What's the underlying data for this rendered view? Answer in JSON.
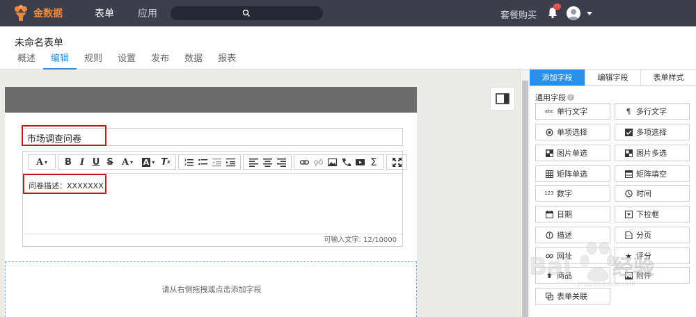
{
  "topnav": {
    "brand": "金数据",
    "items": [
      "表单",
      "应用"
    ],
    "buy_label": "套餐购买",
    "badge": "···"
  },
  "form": {
    "title": "未命名表单",
    "tabs": [
      "概述",
      "编辑",
      "规则",
      "设置",
      "发布",
      "数据",
      "报表"
    ],
    "active_tab": "编辑"
  },
  "editor": {
    "title_value": "市场调查问卷",
    "description": "问卷描述：XXXXXXX",
    "char_count": "可输入文字: 12/10000",
    "drop_hint": "请从右侧拖拽或点击添加字段",
    "toolbar_font_label": "A"
  },
  "panel": {
    "tabs": [
      "添加字段",
      "编辑字段",
      "表单样式"
    ],
    "section_title": "通用字段",
    "fields": [
      {
        "label": "单行文字",
        "icon": "abc-icon"
      },
      {
        "label": "多行文字",
        "icon": "paragraph-icon"
      },
      {
        "label": "单项选择",
        "icon": "radio-icon"
      },
      {
        "label": "多项选择",
        "icon": "checkbox-icon"
      },
      {
        "label": "图片单选",
        "icon": "image-radio-icon"
      },
      {
        "label": "图片多选",
        "icon": "image-checkbox-icon"
      },
      {
        "label": "矩阵单选",
        "icon": "matrix-radio-icon"
      },
      {
        "label": "矩阵填空",
        "icon": "matrix-fill-icon"
      },
      {
        "label": "数字",
        "icon": "number-icon"
      },
      {
        "label": "时间",
        "icon": "clock-icon"
      },
      {
        "label": "日期",
        "icon": "calendar-icon"
      },
      {
        "label": "下拉框",
        "icon": "dropdown-icon"
      },
      {
        "label": "描述",
        "icon": "info-icon"
      },
      {
        "label": "分页",
        "icon": "page-icon"
      },
      {
        "label": "网址",
        "icon": "link-icon"
      },
      {
        "label": "评分",
        "icon": "star-icon"
      },
      {
        "label": "商品",
        "icon": "upload-icon"
      },
      {
        "label": "附件",
        "icon": "attachment-icon"
      },
      {
        "label": "表单关联",
        "icon": "relation-icon"
      }
    ],
    "number_badge": "123"
  },
  "colors": {
    "nav_bg": "#3a3f4b",
    "brand_orange": "#f0883a",
    "accent_blue": "#2a8fe6",
    "highlight_red": "#c0191a"
  }
}
